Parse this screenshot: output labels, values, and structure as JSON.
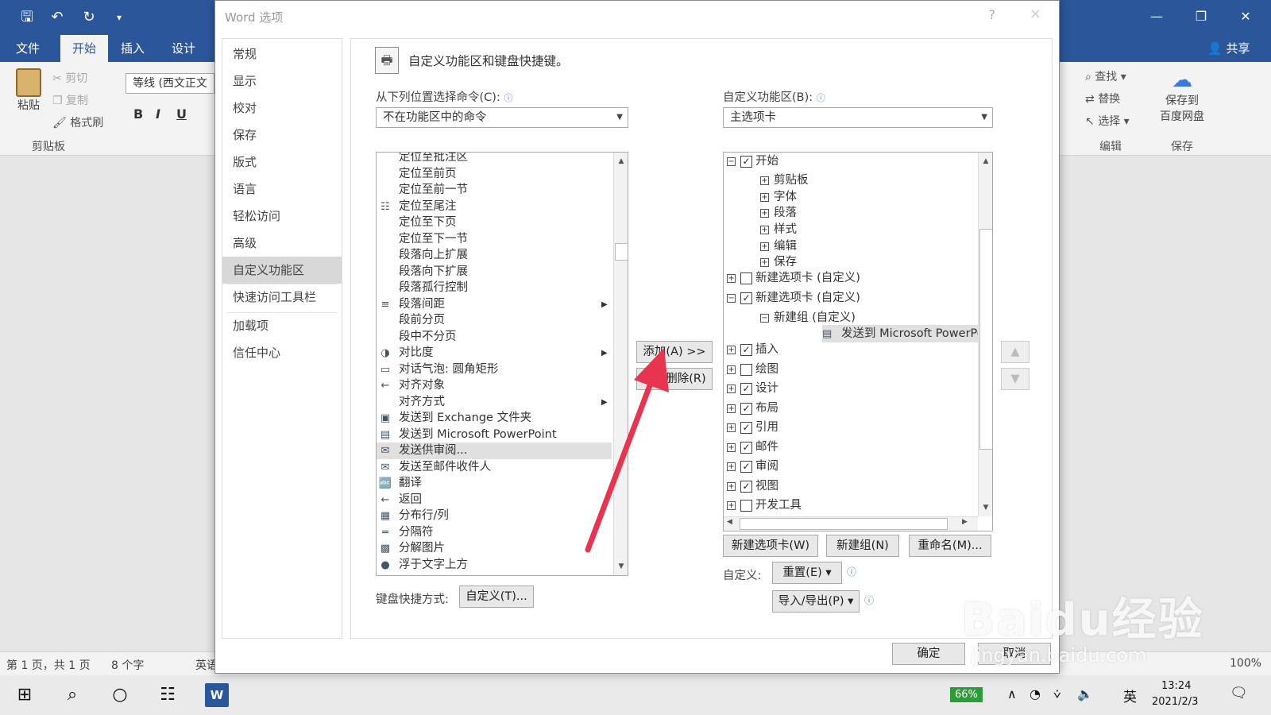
{
  "word": {
    "quick_access": {
      "save_icon": "save-icon",
      "undo_icon": "undo-icon",
      "redo_icon": "redo-icon"
    },
    "tabs": [
      "文件",
      "开始",
      "插入",
      "设计"
    ],
    "active_tab": "开始",
    "share_label": "共享",
    "ribbon": {
      "paste_label": "粘贴",
      "cut_label": "剪切",
      "copy_label": "复制",
      "format_painter_label": "格式刷",
      "clipboard_group": "剪贴板",
      "font_value": "等线 (西文正文",
      "bold": "B",
      "italic": "I",
      "underline": "U",
      "find_label": "查找",
      "replace_label": "替换",
      "select_label": "选择",
      "editing_group": "编辑",
      "save_to_baidu_label_1": "保存到",
      "save_to_baidu_label_2": "百度网盘",
      "save_group": "保存"
    },
    "status": {
      "page": "第 1 页，共 1 页",
      "words": "8 个字",
      "lang": "英语",
      "zoom": "100%"
    }
  },
  "dialog": {
    "title": "Word 选项",
    "help": "?",
    "close": "×",
    "nav": [
      "常规",
      "显示",
      "校对",
      "保存",
      "版式",
      "语言",
      "轻松访问",
      "高级",
      "自定义功能区",
      "快速访问工具栏",
      "加载项",
      "信任中心"
    ],
    "selected_nav": "自定义功能区",
    "heading": "自定义功能区和键盘快捷键。",
    "choose_from_label": "从下列位置选择命令(C):",
    "choose_from_value": "不在功能区中的命令",
    "customize_ribbon_label": "自定义功能区(B):",
    "customize_ribbon_value": "主选项卡",
    "commands": [
      {
        "icon": "",
        "label": "定位至批注区",
        "sub": false
      },
      {
        "icon": "",
        "label": "定位至前页",
        "sub": false
      },
      {
        "icon": "",
        "label": "定位至前一节",
        "sub": false
      },
      {
        "icon": "endnote-icon",
        "label": "定位至尾注",
        "sub": false
      },
      {
        "icon": "",
        "label": "定位至下页",
        "sub": false
      },
      {
        "icon": "",
        "label": "定位至下一节",
        "sub": false
      },
      {
        "icon": "",
        "label": "段落向上扩展",
        "sub": false
      },
      {
        "icon": "",
        "label": "段落向下扩展",
        "sub": false
      },
      {
        "icon": "",
        "label": "段落孤行控制",
        "sub": false
      },
      {
        "icon": "paragraph-spacing-icon",
        "label": "段落间距",
        "sub": true
      },
      {
        "icon": "",
        "label": "段前分页",
        "sub": false
      },
      {
        "icon": "",
        "label": "段中不分页",
        "sub": false
      },
      {
        "icon": "contrast-icon",
        "label": "对比度",
        "sub": true
      },
      {
        "icon": "callout-icon",
        "label": "对话气泡: 圆角矩形",
        "sub": false
      },
      {
        "icon": "align-objects-icon",
        "label": "对齐对象",
        "sub": false
      },
      {
        "icon": "",
        "label": "对齐方式",
        "sub": true
      },
      {
        "icon": "exchange-folder-icon",
        "label": "发送到 Exchange 文件夹",
        "sub": false
      },
      {
        "icon": "powerpoint-icon",
        "label": "发送到 Microsoft PowerPoint",
        "sub": false
      },
      {
        "icon": "send-review-icon",
        "label": "发送供审阅...",
        "sub": false
      },
      {
        "icon": "mail-recipient-icon",
        "label": "发送至邮件收件人",
        "sub": false
      },
      {
        "icon": "translate-icon",
        "label": "翻译",
        "sub": false
      },
      {
        "icon": "back-arrow-icon",
        "label": "返回",
        "sub": false
      },
      {
        "icon": "distribute-rows-icon",
        "label": "分布行/列",
        "sub": false
      },
      {
        "icon": "separator-icon",
        "label": "分隔符",
        "sub": false
      },
      {
        "icon": "ungroup-picture-icon",
        "label": "分解图片",
        "sub": false
      },
      {
        "icon": "bring-front-icon",
        "label": "浮于文字上方",
        "sub": false
      }
    ],
    "selected_command": "发送供审阅...",
    "add_button": "添加(A) >>",
    "remove_button": "<< 删除(R)",
    "tree": [
      {
        "level": 0,
        "exp": "−",
        "chk": true,
        "label": "开始"
      },
      {
        "level": 1,
        "exp": "+",
        "chk": null,
        "label": "剪贴板"
      },
      {
        "level": 1,
        "exp": "+",
        "chk": null,
        "label": "字体"
      },
      {
        "level": 1,
        "exp": "+",
        "chk": null,
        "label": "段落"
      },
      {
        "level": 1,
        "exp": "+",
        "chk": null,
        "label": "样式"
      },
      {
        "level": 1,
        "exp": "+",
        "chk": null,
        "label": "编辑"
      },
      {
        "level": 1,
        "exp": "+",
        "chk": null,
        "label": "保存"
      },
      {
        "level": 0,
        "exp": "+",
        "chk": false,
        "label": "新建选项卡 (自定义)"
      },
      {
        "level": 0,
        "exp": "−",
        "chk": true,
        "label": "新建选项卡 (自定义)"
      },
      {
        "level": 1,
        "exp": "−",
        "chk": null,
        "label": "新建组 (自定义)"
      },
      {
        "level": 2,
        "exp": null,
        "chk": null,
        "label": "发送到 Microsoft PowerPoint"
      },
      {
        "level": 0,
        "exp": "+",
        "chk": true,
        "label": "插入"
      },
      {
        "level": 0,
        "exp": "+",
        "chk": false,
        "label": "绘图"
      },
      {
        "level": 0,
        "exp": "+",
        "chk": true,
        "label": "设计"
      },
      {
        "level": 0,
        "exp": "+",
        "chk": true,
        "label": "布局"
      },
      {
        "level": 0,
        "exp": "+",
        "chk": true,
        "label": "引用"
      },
      {
        "level": 0,
        "exp": "+",
        "chk": true,
        "label": "邮件"
      },
      {
        "level": 0,
        "exp": "+",
        "chk": true,
        "label": "审阅"
      },
      {
        "level": 0,
        "exp": "+",
        "chk": true,
        "label": "视图"
      },
      {
        "level": 0,
        "exp": "+",
        "chk": false,
        "label": "开发工具"
      }
    ],
    "new_tab_button": "新建选项卡(W)",
    "new_group_button": "新建组(N)",
    "rename_button": "重命名(M)...",
    "customizations_label": "自定义:",
    "reset_button": "重置(E) ▾",
    "import_export_button": "导入/导出(P) ▾",
    "keyboard_label": "键盘快捷方式:",
    "keyboard_button": "自定义(T)...",
    "ok_button": "确定",
    "cancel_button": "取消"
  },
  "taskbar": {
    "battery": "66%",
    "ime": "英",
    "time": "13:24",
    "date": "2021/2/3"
  },
  "watermark": {
    "brand": "Baidu经验",
    "url": "jingyan.baidu.com"
  },
  "colors": {
    "word_blue": "#2b579a",
    "arrow_red": "#e8344e",
    "selection": "#e0e0e0"
  }
}
